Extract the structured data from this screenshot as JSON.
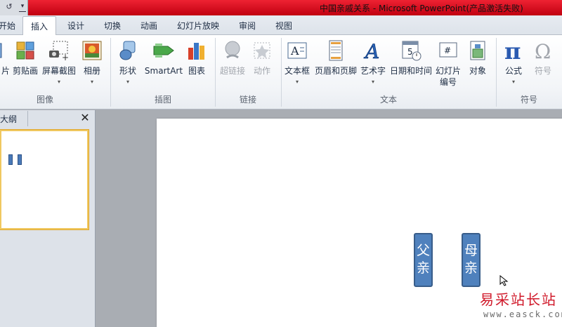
{
  "window": {
    "title": "中国亲戚关系 - Microsoft PowerPoint(产品激活失败)",
    "qat_icon_1": "↺",
    "qat_icon_2": "▾"
  },
  "tabs": [
    "开始",
    "插入",
    "设计",
    "切换",
    "动画",
    "幻灯片放映",
    "审阅",
    "视图"
  ],
  "active_tab": "插入",
  "ribbon": {
    "groups": [
      {
        "label": "图像"
      },
      {
        "label": "插图"
      },
      {
        "label": "链接"
      },
      {
        "label": "文本"
      },
      {
        "label": "符号"
      }
    ],
    "buttons": {
      "picture_partial": "片",
      "clipart": "剪贴画",
      "screenshot": "屏幕截图",
      "photo_album": "相册",
      "shapes": "形状",
      "smartart": "SmartArt",
      "chart": "图表",
      "hyperlink": "超链接",
      "action": "动作",
      "textbox": "文本框",
      "header_footer": "页眉和页脚",
      "wordart": "艺术字",
      "datetime": "日期和时间",
      "slide_number_1": "幻灯片",
      "slide_number_2": "编号",
      "object": "对象",
      "equation": "公式",
      "symbol": "符号"
    },
    "dropdown_arrow": "▾"
  },
  "left_panel": {
    "tab_label": "大纲",
    "close_icon": "✕"
  },
  "slide": {
    "boxes": [
      {
        "text": "父亲"
      },
      {
        "text": "母亲"
      }
    ]
  },
  "watermark": {
    "text": "易采站长站",
    "url": "www.easck.com"
  },
  "colors": {
    "title_bar": "#cc0010",
    "shape_fill": "#4f81bd",
    "shape_border": "#385d8a",
    "thumbnail_border": "#f0c860",
    "watermark": "#d0192a"
  }
}
